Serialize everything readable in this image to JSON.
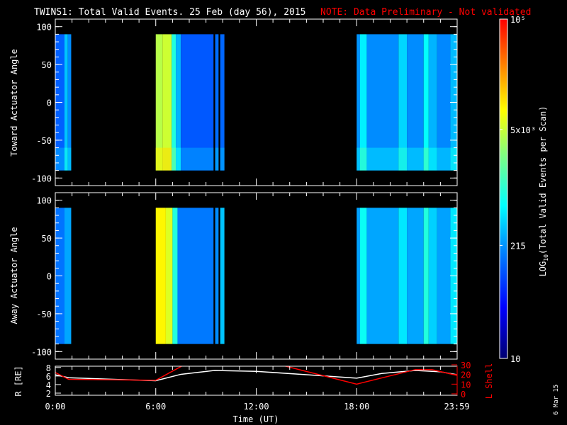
{
  "title": {
    "main": "TWINS1: Total Valid Events. 25 Feb (day  56), 2015",
    "note": "NOTE: Data Preliminary - Not validated",
    "note_color": "#ff0000"
  },
  "date_stamp": "6 Mar 15",
  "colorbar": {
    "label": "LOG10(Total Valid Events per Scan)",
    "label_prefix": "LOG",
    "label_sub": "10",
    "label_suffix": "(Total Valid Events per Scan)",
    "min": 10,
    "max": 100000,
    "scale": "log",
    "ticks": [
      {
        "value": 10,
        "label": "10"
      },
      {
        "value": 215,
        "label": "215"
      },
      {
        "value": 5000,
        "label": "5x10³"
      },
      {
        "value": 100000,
        "label": "10⁵"
      }
    ]
  },
  "chart_data": [
    {
      "type": "heatmap",
      "ylabel": "Toward Actuator Angle",
      "ylim": [
        -110,
        110
      ],
      "yticks": [
        "100",
        "50",
        "0",
        "-50",
        "-100"
      ],
      "yrange_data": [
        -90,
        90
      ],
      "columns_hours_value": [
        [
          0,
          0.55,
          120
        ],
        [
          0.55,
          0.75,
          350
        ],
        [
          0.75,
          0.95,
          200
        ],
        [
          6.0,
          6.4,
          4200
        ],
        [
          6.4,
          6.95,
          5200
        ],
        [
          6.95,
          7.2,
          900
        ],
        [
          7.2,
          7.5,
          300
        ],
        [
          7.5,
          9.45,
          110
        ],
        [
          9.55,
          9.75,
          140
        ],
        [
          9.85,
          10.1,
          130
        ],
        [
          18.0,
          18.2,
          220
        ],
        [
          18.2,
          18.6,
          550
        ],
        [
          18.6,
          20.5,
          200
        ],
        [
          20.5,
          21.0,
          420
        ],
        [
          21.0,
          22.0,
          200
        ],
        [
          22.0,
          22.3,
          650
        ],
        [
          22.3,
          22.8,
          300
        ],
        [
          22.8,
          23.6,
          190
        ],
        [
          23.6,
          24,
          320
        ]
      ]
    },
    {
      "type": "heatmap",
      "ylabel": "Away Actuator Angle",
      "ylim": [
        -110,
        110
      ],
      "yticks": [
        "100",
        "50",
        "0",
        "-50",
        "-100"
      ],
      "yrange_data": [
        -90,
        90
      ],
      "columns_hours_value": [
        [
          0,
          0.55,
          150
        ],
        [
          0.55,
          0.95,
          260
        ],
        [
          6.0,
          6.6,
          9000
        ],
        [
          6.6,
          7.0,
          6000
        ],
        [
          7.0,
          7.3,
          900
        ],
        [
          7.3,
          9.45,
          160
        ],
        [
          9.55,
          9.75,
          200
        ],
        [
          9.85,
          10.1,
          350
        ],
        [
          18.0,
          18.2,
          250
        ],
        [
          18.2,
          18.6,
          700
        ],
        [
          18.6,
          20.5,
          260
        ],
        [
          20.5,
          21.0,
          500
        ],
        [
          21.0,
          22.0,
          260
        ],
        [
          22.0,
          22.3,
          900
        ],
        [
          22.3,
          22.8,
          400
        ],
        [
          22.8,
          23.6,
          250
        ],
        [
          23.6,
          24,
          500
        ]
      ]
    },
    {
      "type": "line",
      "ylabel": "R [RE]",
      "y2label": "L Shell",
      "xlabel": "Time (UT)",
      "ylim": [
        1.5,
        8.3
      ],
      "y2lim": [
        0,
        30
      ],
      "xticks": [
        "0:00",
        "6:00",
        "12:00",
        "18:00",
        "23:59"
      ],
      "yticks": [
        "2",
        "4",
        "6",
        "8"
      ],
      "y2ticks": [
        "0",
        "10",
        "20",
        "30"
      ],
      "series": [
        {
          "axis": "left",
          "color": "#ffffff",
          "points": [
            [
              0,
              6.3
            ],
            [
              0.8,
              5.6
            ],
            [
              3,
              5.3
            ],
            [
              6,
              4.9
            ],
            [
              7.5,
              6.4
            ],
            [
              9.5,
              7.3
            ],
            [
              12,
              7.1
            ],
            [
              15,
              6.3
            ],
            [
              18,
              5.5
            ],
            [
              19.5,
              6.6
            ],
            [
              21.5,
              7.3
            ],
            [
              23,
              7.0
            ],
            [
              24,
              6.3
            ]
          ]
        },
        {
          "axis": "right",
          "color": "#ff0000",
          "points": [
            [
              0,
              22
            ],
            [
              0.8,
              15
            ],
            [
              3.2,
              14.5
            ],
            [
              6,
              14
            ],
            [
              7.8,
              31
            ],
            [
              13.2,
              31
            ],
            [
              18,
              10
            ],
            [
              21.5,
              25
            ],
            [
              22.5,
              25
            ],
            [
              24,
              19
            ]
          ]
        }
      ]
    }
  ]
}
